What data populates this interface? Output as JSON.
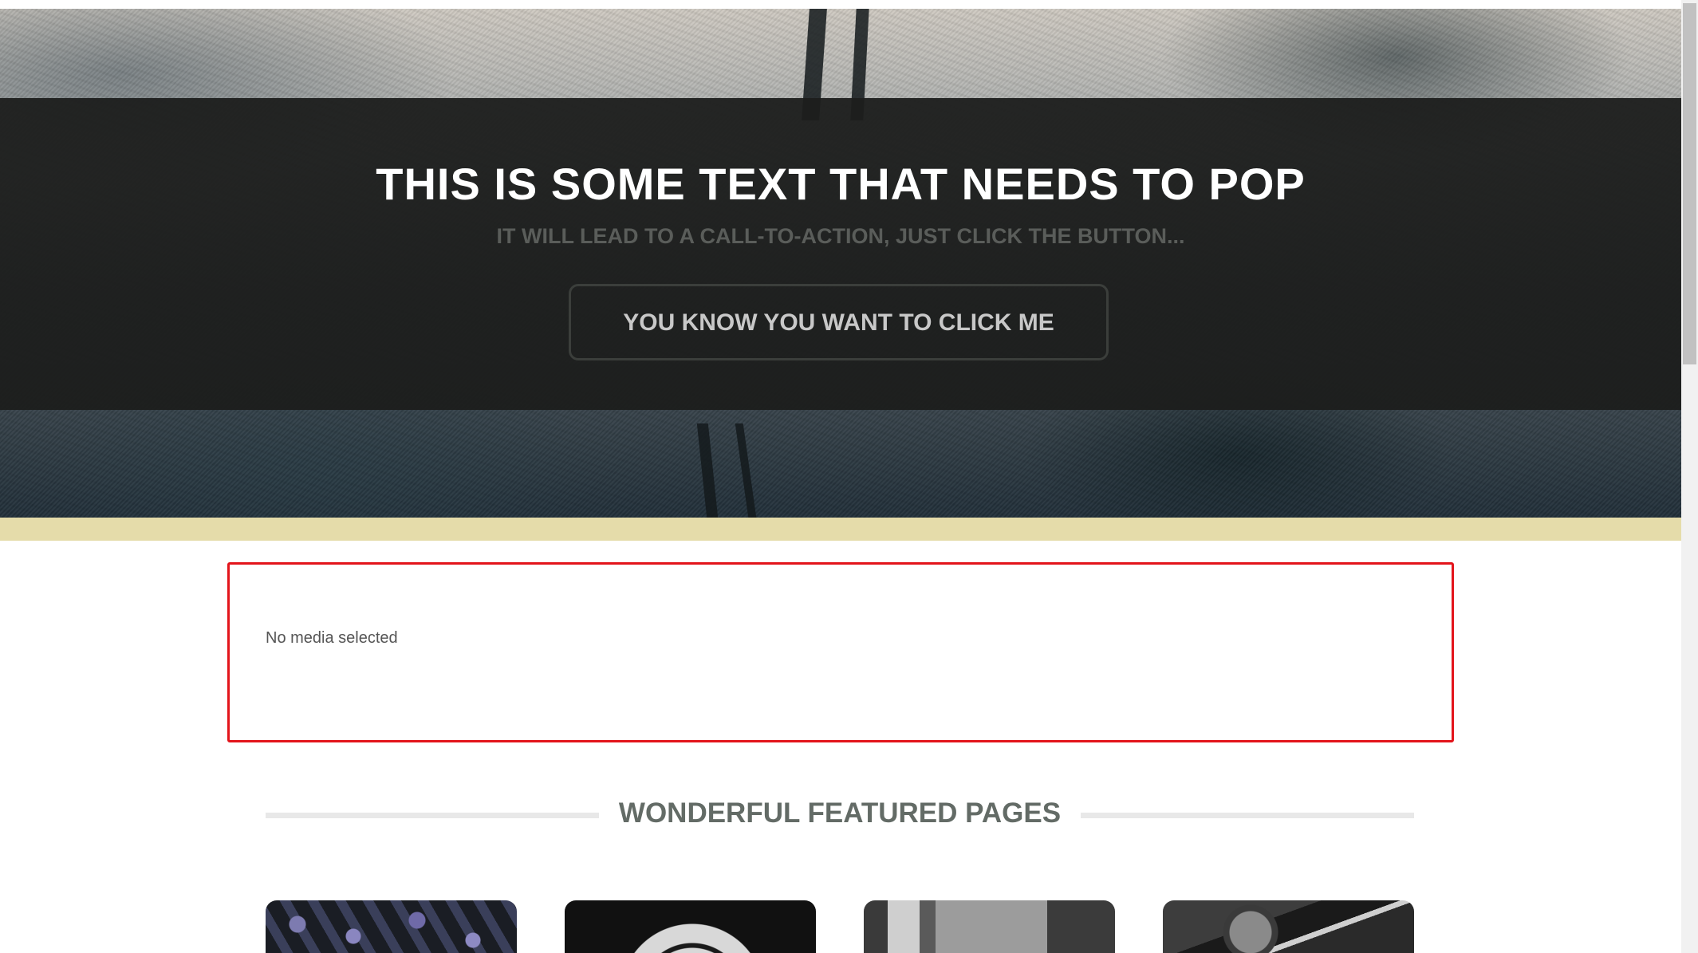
{
  "hero": {
    "title": "THIS IS SOME TEXT THAT NEEDS TO POP",
    "subtitle": "IT WILL LEAD TO A CALL-TO-ACTION, JUST CLICK THE BUTTON...",
    "cta_label": "YOU KNOW YOU WANT TO CLICK ME"
  },
  "media": {
    "placeholder_text": "No media selected",
    "border_color": "#e3141b"
  },
  "featured": {
    "heading": "WONDERFUL FEATURED PAGES",
    "cards": [
      {
        "image": "mixing-console-knobs-image"
      },
      {
        "image": "compass-watch-image"
      },
      {
        "image": "vintage-meter-panel-image"
      },
      {
        "image": "vintage-radio-dial-image"
      }
    ]
  },
  "colors": {
    "cream_band": "#e5dcaa",
    "hero_overlay": "#1c1e1c",
    "heading_gray": "#636b66"
  }
}
